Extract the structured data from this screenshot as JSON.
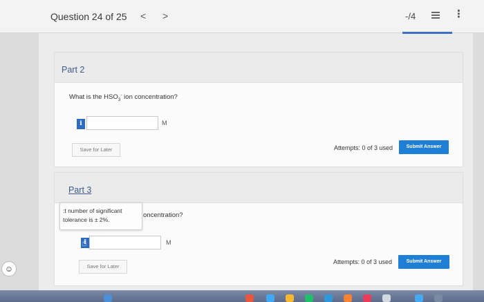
{
  "header": {
    "question_label": "Question 24 of 25",
    "prev_glyph": "<",
    "next_glyph": ">",
    "score": "-/4",
    "list_icon": "list-icon",
    "more_icon": "kebab-icon"
  },
  "part2": {
    "title": "Part 2",
    "question_prefix": "What is the HSO",
    "question_sub": "3",
    "question_sup": "-",
    "question_suffix": " ion concentration?",
    "info_glyph": "i",
    "input_value": "",
    "unit": "M",
    "save_label": "Save for Later",
    "attempts": "Attempts: 0 of 3 used",
    "submit_label": "Submit Answer"
  },
  "part3": {
    "title": "Part 3",
    "tooltip_line1": ":t number of significant",
    "tooltip_line2": "tolerance is ± 2%.",
    "question_fragment": "oncentration?",
    "input_value": "",
    "unit": "M",
    "save_label": "Save for Later",
    "attempts": "Attempts: 0 of 3 used",
    "submit_label": "Submit Answer"
  },
  "a11y_icon": "accessibility-icon",
  "colors": {
    "accent": "#1f7fd6",
    "info_button": "#2d6cc0",
    "part_title": "#3d5a8a"
  }
}
